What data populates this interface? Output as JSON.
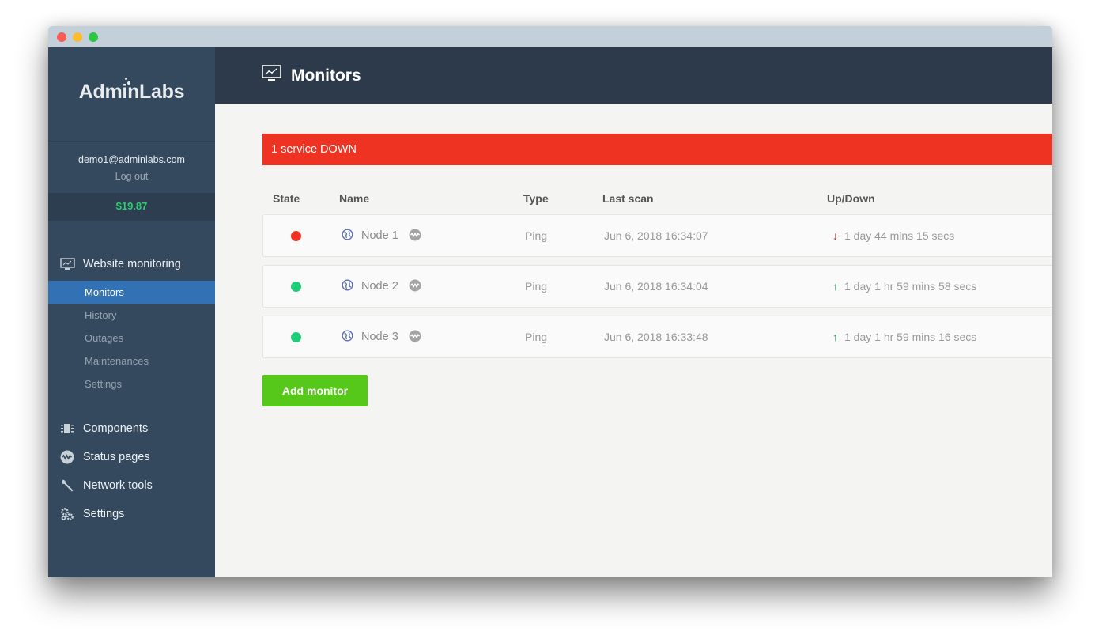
{
  "window": {
    "controls": [
      "close",
      "minimize",
      "maximize"
    ]
  },
  "sidebar": {
    "logo": "AdminLabs",
    "user_email": "demo1@adminlabs.com",
    "logout_label": "Log out",
    "balance": "$19.87",
    "website_monitoring": {
      "label": "Website monitoring",
      "icon": "monitor-chart-icon",
      "items": [
        {
          "label": "Monitors",
          "active": true
        },
        {
          "label": "History",
          "active": false
        },
        {
          "label": "Outages",
          "active": false
        },
        {
          "label": "Maintenances",
          "active": false
        },
        {
          "label": "Settings",
          "active": false
        }
      ]
    },
    "main_items": [
      {
        "label": "Components",
        "icon": "chip-icon"
      },
      {
        "label": "Status pages",
        "icon": "status-wave-icon"
      },
      {
        "label": "Network tools",
        "icon": "wrench-icon"
      },
      {
        "label": "Settings",
        "icon": "gears-icon"
      }
    ]
  },
  "header": {
    "title": "Monitors",
    "icon": "monitor-chart-icon"
  },
  "alert": {
    "text": "1 service DOWN",
    "color": "#ef3322"
  },
  "table": {
    "columns": [
      "State",
      "Name",
      "Type",
      "Last scan",
      "Up/Down"
    ],
    "rows": [
      {
        "state": "down",
        "state_color": "#ef3322",
        "name": "Node 1",
        "type": "Ping",
        "last_scan": "Jun 6, 2018 16:34:07",
        "direction": "down",
        "duration": "1 day 44 mins 15 secs"
      },
      {
        "state": "up",
        "state_color": "#1fcc77",
        "name": "Node 2",
        "type": "Ping",
        "last_scan": "Jun 6, 2018 16:34:04",
        "direction": "up",
        "duration": "1 day 1 hr 59 mins 58 secs"
      },
      {
        "state": "up",
        "state_color": "#1fcc77",
        "name": "Node 3",
        "type": "Ping",
        "last_scan": "Jun 6, 2018 16:33:48",
        "direction": "up",
        "duration": "1 day 1 hr 59 mins 16 secs"
      }
    ]
  },
  "actions": {
    "add_monitor_label": "Add monitor"
  },
  "colors": {
    "sidebar_bg": "#34495e",
    "topbar_bg": "#2c3a4b",
    "active_item": "#3271b4",
    "balance": "#2ecc71",
    "add_button": "#55c81a",
    "up_arrow": "#14a85c",
    "down_arrow": "#c8281e"
  }
}
